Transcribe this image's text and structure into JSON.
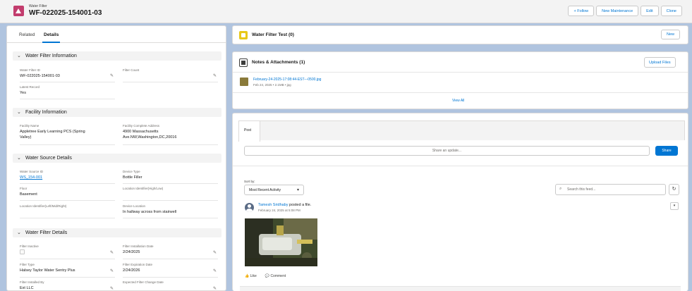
{
  "header": {
    "object_type": "Water Filter",
    "record_title": "WF-022025-154001-03",
    "buttons": {
      "follow": "+ Follow",
      "new_maintenance": "New Maintenance",
      "edit": "Edit",
      "clone": "Clone"
    }
  },
  "left_tabs": {
    "related": "Related",
    "details": "Details"
  },
  "sections": {
    "water_filter_information": {
      "title": "Water Filter Information",
      "water_filter_id": {
        "label": "Water Filter ID",
        "value": "WF-022025-154001-03"
      },
      "filter_count": {
        "label": "Filter Count",
        "value": ""
      },
      "latest_record": {
        "label": "Latest Record",
        "value": "Yes"
      }
    },
    "facility_information": {
      "title": "Facility Information",
      "facility_name": {
        "label": "Facility Name",
        "line1": "Appletree Early Learning PCS (Spring",
        "line2": "Valley)"
      },
      "facility_address": {
        "label": "Facility Complete Address",
        "line1": "4900 Massachusetts",
        "line2": "Ave.NW,Washington,DC,20016"
      }
    },
    "water_source_details": {
      "title": "Water Source Details",
      "water_source_id": {
        "label": "Water Source ID",
        "value": "WS_154-001"
      },
      "device_type": {
        "label": "Device Type",
        "value": "Bottle Filler"
      },
      "floor": {
        "label": "Floor",
        "value": "Basement"
      },
      "location_identifier_hl": {
        "label": "Location Identifier(High/Low)",
        "value": ""
      },
      "location_identifier_lmr": {
        "label": "Location Identifier(Left/Mid/Right)",
        "value": ""
      },
      "device_location": {
        "label": "Device Location",
        "value": "In hallway across from stairwell"
      }
    },
    "water_filter_details": {
      "title": "Water Filter Details",
      "filter_inactive": {
        "label": "Filter Inactive",
        "checked": false
      },
      "filter_installation_date": {
        "label": "Filter Installation Date",
        "value": "2/24/2025"
      },
      "filter_type": {
        "label": "Filter Type",
        "value": "Halsey Taylor Water Sentry Plus"
      },
      "filter_expiration_date": {
        "label": "Filter Expiration Date",
        "value": "2/24/2026"
      },
      "filter_installed_by": {
        "label": "Filter Installed By",
        "value": "Ext LLC"
      },
      "expected_filter_change_date": {
        "label": "Expected Filter Change Date",
        "value": ""
      }
    }
  },
  "water_filter_test": {
    "title": "Water Filter Test (0)",
    "new_button": "New"
  },
  "notes_attachments": {
    "title": "Notes & Attachments (1)",
    "upload_button": "Upload Files",
    "file_name": "February-24-2025-17:08:44-EST---0500.jpg",
    "file_meta": "Feb 24, 2025 • 2.1MB • jpg",
    "view_all": "View All"
  },
  "feed": {
    "publisher_tab": "Post",
    "share_placeholder": "Share an update...",
    "share_button": "Share",
    "sort_label": "Sort by:",
    "sort_value": "Most Recent Activity",
    "search_placeholder": "Search this feed...",
    "post": {
      "author": "Tamesh Sridhaby",
      "action": " posted a file.",
      "date": "February 24, 2025 at 5:08 PM",
      "like": "Like",
      "comment": "Comment"
    }
  },
  "colors": {
    "brand_blue": "#0176d3",
    "object_icon": "#c23c6d",
    "test_icon": "#e8c81a",
    "page_bg": "#b0c4df"
  }
}
